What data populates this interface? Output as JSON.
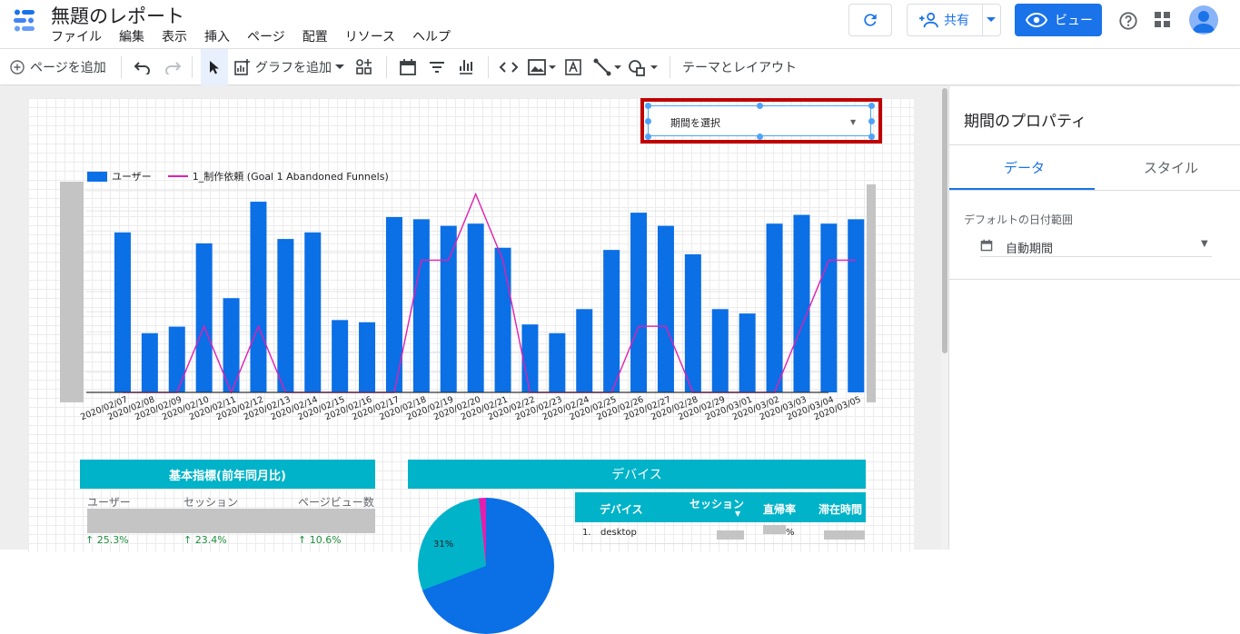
{
  "app": {
    "title": "無題のレポート",
    "menu": [
      "ファイル",
      "編集",
      "表示",
      "挿入",
      "ページ",
      "配置",
      "リソース",
      "ヘルプ"
    ],
    "share_label": "共有",
    "view_label": "ビュー"
  },
  "toolbar": {
    "add_page": "ページを追加",
    "add_chart": "グラフを追加",
    "theme_layout": "テーマとレイアウト"
  },
  "date_control": {
    "label": "期間を選択"
  },
  "legend": {
    "bar": "ユーザー",
    "line": "1_制作依頼 (Goal 1 Abandoned Funnels)"
  },
  "chart_data": {
    "type": "bar",
    "categories": [
      "2020/02/07",
      "2020/02/08",
      "2020/02/09",
      "2020/02/10",
      "2020/02/11",
      "2020/02/12",
      "2020/02/13",
      "2020/02/14",
      "2020/02/15",
      "2020/02/16",
      "2020/02/17",
      "2020/02/18",
      "2020/02/19",
      "2020/02/20",
      "2020/02/21",
      "2020/02/22",
      "2020/02/23",
      "2020/02/24",
      "2020/02/25",
      "2020/02/26",
      "2020/02/27",
      "2020/02/28",
      "2020/02/29",
      "2020/03/01",
      "2020/03/02",
      "2020/03/03",
      "2020/03/04",
      "2020/03/05"
    ],
    "series": [
      {
        "name": "ユーザー",
        "type": "bar",
        "color": "#0b6fe6",
        "values": [
          73,
          27,
          30,
          68,
          43,
          87,
          70,
          73,
          33,
          32,
          80,
          79,
          76,
          77,
          66,
          31,
          27,
          38,
          65,
          82,
          76,
          63,
          38,
          36,
          77,
          81,
          77,
          79
        ]
      },
      {
        "name": "1_制作依頼 (Goal 1 Abandoned Funnels)",
        "type": "line",
        "color": "#e21fb0",
        "values": [
          0,
          0,
          0,
          1,
          0,
          1,
          0,
          0,
          0,
          0,
          0,
          2,
          2,
          3,
          2,
          0,
          0,
          0,
          0,
          1,
          1,
          0,
          0,
          0,
          0,
          1,
          2,
          2
        ]
      }
    ]
  },
  "scorecard": {
    "title": "基本指標(前年同月比)",
    "columns": [
      "ユーザー",
      "セッション",
      "ページビュー数"
    ],
    "deltas": [
      "↑ 25.3%",
      "↑ 23.4%",
      "↑ 10.6%"
    ]
  },
  "device": {
    "title": "デバイス",
    "pie_label": "31%",
    "table_headers": [
      "デバイス",
      "セッション",
      "直帰率",
      "滞在時間"
    ],
    "rows": [
      {
        "index": "1.",
        "device": "desktop",
        "bounce_suffix": "%"
      }
    ]
  },
  "panel": {
    "title": "期間のプロパティ",
    "tabs": [
      "データ",
      "スタイル"
    ],
    "default_range_label": "デフォルトの日付範囲",
    "default_range_value": "自動期間"
  }
}
